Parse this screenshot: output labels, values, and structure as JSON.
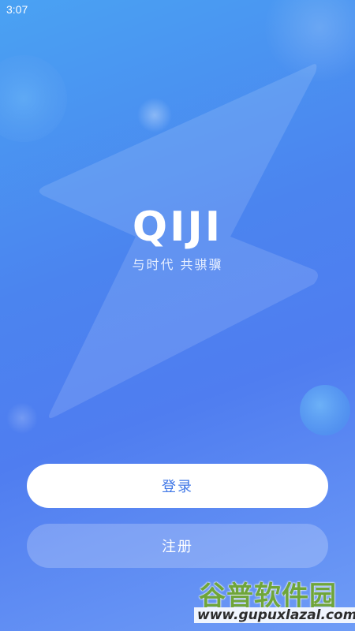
{
  "status_bar": {
    "time": "3:07"
  },
  "brand": {
    "logo": "QIJI",
    "slogan": "与时代 共骐骥"
  },
  "actions": {
    "login_label": "登录",
    "register_label": "注册"
  },
  "watermark": {
    "title": "谷普软件园",
    "url": "www.gupuxlazal.com"
  },
  "colors": {
    "background_top": "#4aa2f3",
    "background_mid": "#4b84ef",
    "background_bottom": "#6f9cf6",
    "login_text": "#3e76e6",
    "watermark_green": "#6fa53a"
  }
}
